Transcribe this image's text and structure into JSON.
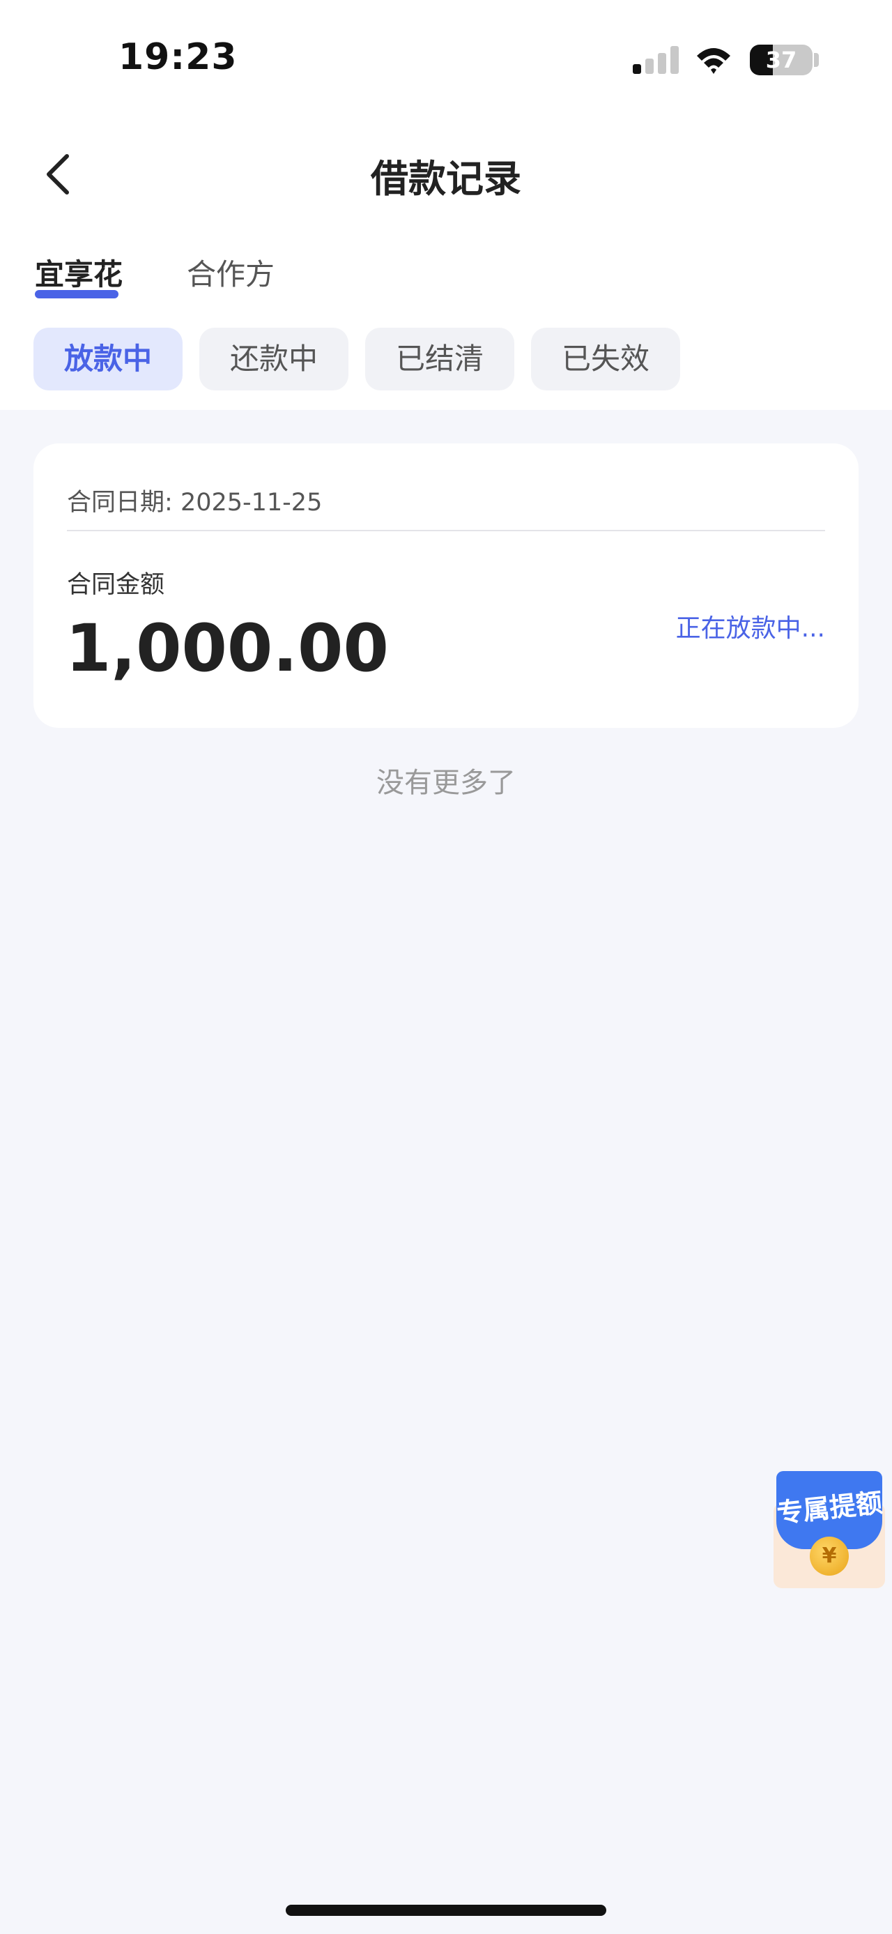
{
  "status_bar": {
    "time": "19:23",
    "battery_level": "37",
    "battery_percent": 37,
    "signal_bars_active": 1,
    "signal_bars_total": 4
  },
  "nav": {
    "title": "借款记录",
    "back_icon": "chevron-left-icon"
  },
  "provider_tabs": [
    {
      "label": "宜享花",
      "active": true
    },
    {
      "label": "合作方",
      "active": false
    }
  ],
  "filter_chips": [
    {
      "label": "放款中",
      "active": true
    },
    {
      "label": "还款中",
      "active": false
    },
    {
      "label": "已结清",
      "active": false
    },
    {
      "label": "已失效",
      "active": false
    }
  ],
  "records": [
    {
      "date_label": "合同日期:",
      "date": "2025-11-25",
      "amount_label": "合同金额",
      "amount": "1,000.00",
      "status": "正在放款中..."
    }
  ],
  "list_end_text": "没有更多了",
  "promo": {
    "label": "专属提额",
    "coin_symbol": "¥"
  },
  "colors": {
    "accent": "#4a63e6",
    "background": "#f5f6fb",
    "card": "#ffffff",
    "chip_inactive": "#f1f2f6",
    "chip_active": "#e3e8fd"
  }
}
